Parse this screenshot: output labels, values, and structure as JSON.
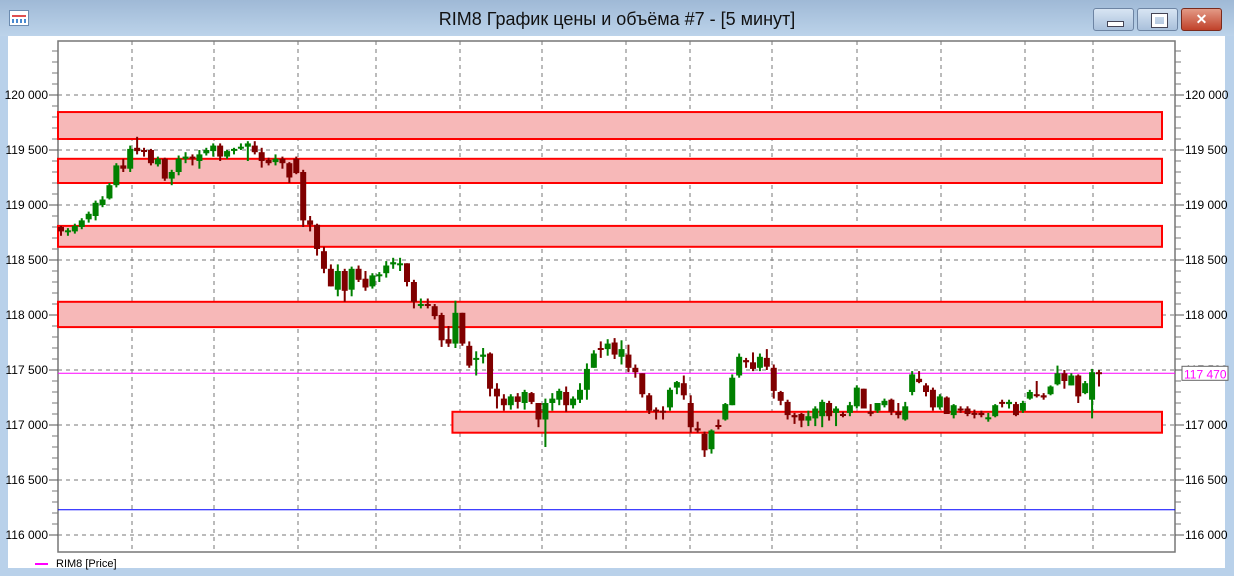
{
  "window": {
    "title": "RIM8 График цены и объёма #7 - [5 минут]",
    "buttons": [
      "minimize",
      "maximize",
      "close"
    ]
  },
  "legend": {
    "label": "RIM8 [Price]",
    "color": "#ff00ff"
  },
  "chart_data": {
    "type": "candlestick",
    "ylim": [
      115970,
      120470
    ],
    "y_ticks": [
      116000,
      116500,
      117000,
      117500,
      118000,
      118500,
      119000,
      119500,
      120000
    ],
    "y_tick_labels": [
      "116 000",
      "116 500",
      "117 000",
      "117 500",
      "118 000",
      "118 500",
      "119 000",
      "119 500",
      "120 000"
    ],
    "grid": true,
    "colors": {
      "up": "#008000",
      "down": "#800000",
      "zone_fill": "#f7b8b8",
      "zone_border": "#ff0000",
      "last_price": "#ff00ff",
      "level_line": "#0000ff"
    },
    "last_price": {
      "value": 117470,
      "label": "117 470"
    },
    "level_line": 116230,
    "zones": [
      {
        "low": 119600,
        "high": 119845,
        "from_candle": 0
      },
      {
        "low": 119200,
        "high": 119420,
        "from_candle": 0
      },
      {
        "low": 118620,
        "high": 118810,
        "from_candle": 0
      },
      {
        "low": 117890,
        "high": 118120,
        "from_candle": 0
      },
      {
        "low": 116930,
        "high": 117120,
        "from_candle": 57
      }
    ],
    "candles_ohlc": [
      [
        118800,
        118810,
        118720,
        118760
      ],
      [
        118760,
        118790,
        118720,
        118770
      ],
      [
        118760,
        118830,
        118740,
        118810
      ],
      [
        118800,
        118880,
        118780,
        118860
      ],
      [
        118870,
        118940,
        118840,
        118920
      ],
      [
        118900,
        119040,
        118860,
        119020
      ],
      [
        119000,
        119080,
        118980,
        119050
      ],
      [
        119060,
        119200,
        119050,
        119180
      ],
      [
        119180,
        119380,
        119160,
        119360
      ],
      [
        119360,
        119420,
        119300,
        119330
      ],
      [
        119330,
        119540,
        119300,
        119510
      ],
      [
        119520,
        119620,
        119460,
        119490
      ],
      [
        119500,
        119520,
        119440,
        119490
      ],
      [
        119500,
        119510,
        119360,
        119380
      ],
      [
        119370,
        119440,
        119350,
        119420
      ],
      [
        119420,
        119430,
        119220,
        119240
      ],
      [
        119240,
        119320,
        119180,
        119300
      ],
      [
        119300,
        119450,
        119270,
        119420
      ],
      [
        119420,
        119480,
        119380,
        119440
      ],
      [
        119440,
        119460,
        119360,
        119430
      ],
      [
        119400,
        119500,
        119330,
        119460
      ],
      [
        119470,
        119520,
        119450,
        119500
      ],
      [
        119490,
        119560,
        119440,
        119540
      ],
      [
        119540,
        119560,
        119400,
        119440
      ],
      [
        119440,
        119500,
        119420,
        119490
      ],
      [
        119500,
        119520,
        119460,
        119510
      ],
      [
        119520,
        119560,
        119500,
        119530
      ],
      [
        119530,
        119580,
        119400,
        119560
      ],
      [
        119540,
        119580,
        119460,
        119480
      ],
      [
        119480,
        119520,
        119340,
        119400
      ],
      [
        119410,
        119430,
        119360,
        119380
      ],
      [
        119390,
        119460,
        119360,
        119420
      ],
      [
        119420,
        119440,
        119330,
        119380
      ],
      [
        119380,
        119390,
        119200,
        119250
      ],
      [
        119420,
        119440,
        119280,
        119290
      ],
      [
        119300,
        119320,
        118800,
        118860
      ],
      [
        118860,
        118900,
        118760,
        118820
      ],
      [
        118820,
        118830,
        118540,
        118600
      ],
      [
        118580,
        118620,
        118380,
        118420
      ],
      [
        118420,
        118460,
        118260,
        118260
      ],
      [
        118230,
        118460,
        118170,
        118400
      ],
      [
        118400,
        118420,
        118120,
        118220
      ],
      [
        118230,
        118440,
        118170,
        118420
      ],
      [
        118420,
        118450,
        118300,
        118320
      ],
      [
        118330,
        118400,
        118220,
        118250
      ],
      [
        118260,
        118380,
        118240,
        118360
      ],
      [
        118360,
        118390,
        118300,
        118370
      ],
      [
        118380,
        118490,
        118340,
        118450
      ],
      [
        118460,
        118520,
        118420,
        118480
      ],
      [
        118470,
        118520,
        118400,
        118470
      ],
      [
        118470,
        118470,
        118260,
        118300
      ],
      [
        118300,
        118320,
        118060,
        118120
      ],
      [
        118100,
        118150,
        118060,
        118100
      ],
      [
        118100,
        118150,
        118060,
        118090
      ],
      [
        118080,
        118100,
        117960,
        117990
      ],
      [
        118000,
        118020,
        117710,
        117770
      ],
      [
        117780,
        117900,
        117710,
        117740
      ],
      [
        117740,
        118130,
        117700,
        118020
      ],
      [
        118020,
        118020,
        117720,
        117740
      ],
      [
        117720,
        117760,
        117520,
        117540
      ],
      [
        117600,
        117670,
        117450,
        117610
      ],
      [
        117620,
        117700,
        117560,
        117640
      ],
      [
        117650,
        117660,
        117260,
        117330
      ],
      [
        117330,
        117380,
        117150,
        117260
      ],
      [
        117240,
        117280,
        117130,
        117180
      ],
      [
        117180,
        117280,
        117140,
        117260
      ],
      [
        117260,
        117290,
        117150,
        117210
      ],
      [
        117200,
        117320,
        117140,
        117300
      ],
      [
        117290,
        117300,
        117190,
        117210
      ],
      [
        117200,
        117200,
        116980,
        117050
      ],
      [
        117050,
        117240,
        116800,
        117200
      ],
      [
        117200,
        117290,
        117130,
        117240
      ],
      [
        117230,
        117330,
        117180,
        117310
      ],
      [
        117300,
        117350,
        117120,
        117180
      ],
      [
        117180,
        117260,
        117150,
        117240
      ],
      [
        117230,
        117380,
        117200,
        117320
      ],
      [
        117320,
        117560,
        117230,
        117510
      ],
      [
        117520,
        117680,
        117520,
        117650
      ],
      [
        117700,
        117760,
        117610,
        117690
      ],
      [
        117690,
        117780,
        117630,
        117740
      ],
      [
        117750,
        117790,
        117600,
        117640
      ],
      [
        117620,
        117770,
        117550,
        117690
      ],
      [
        117640,
        117730,
        117480,
        117520
      ],
      [
        117520,
        117550,
        117430,
        117480
      ],
      [
        117470,
        117470,
        117250,
        117280
      ],
      [
        117270,
        117290,
        117100,
        117130
      ],
      [
        117140,
        117160,
        117050,
        117130
      ],
      [
        117130,
        117170,
        117050,
        117120
      ],
      [
        117160,
        117340,
        117130,
        117320
      ],
      [
        117340,
        117400,
        117280,
        117390
      ],
      [
        117380,
        117450,
        117230,
        117270
      ],
      [
        117200,
        117270,
        116930,
        116980
      ],
      [
        116970,
        117030,
        116930,
        116950
      ],
      [
        116920,
        116940,
        116710,
        116770
      ],
      [
        116780,
        116960,
        116740,
        116950
      ],
      [
        117000,
        117050,
        116960,
        116990
      ],
      [
        117050,
        117200,
        117040,
        117190
      ],
      [
        117180,
        117460,
        117180,
        117430
      ],
      [
        117450,
        117650,
        117430,
        117620
      ],
      [
        117590,
        117610,
        117520,
        117570
      ],
      [
        117570,
        117660,
        117490,
        117510
      ],
      [
        117520,
        117650,
        117490,
        117620
      ],
      [
        117610,
        117690,
        117500,
        117530
      ],
      [
        117520,
        117550,
        117240,
        117310
      ],
      [
        117300,
        117310,
        117180,
        117220
      ],
      [
        117210,
        117230,
        117050,
        117090
      ],
      [
        117090,
        117110,
        117010,
        117070
      ],
      [
        117100,
        117110,
        116980,
        117040
      ],
      [
        117040,
        117130,
        116990,
        117080
      ],
      [
        117060,
        117170,
        116990,
        117150
      ],
      [
        117080,
        117230,
        116980,
        117210
      ],
      [
        117200,
        117220,
        117040,
        117080
      ],
      [
        117110,
        117170,
        116990,
        117150
      ],
      [
        117100,
        117120,
        117070,
        117090
      ],
      [
        117110,
        117210,
        117080,
        117180
      ],
      [
        117170,
        117360,
        117150,
        117340
      ],
      [
        117330,
        117330,
        117150,
        117150
      ],
      [
        117120,
        117190,
        117080,
        117110
      ],
      [
        117130,
        117200,
        117110,
        117200
      ],
      [
        117180,
        117240,
        117160,
        117220
      ],
      [
        117230,
        117240,
        117090,
        117120
      ],
      [
        117120,
        117200,
        117060,
        117090
      ],
      [
        117050,
        117210,
        117040,
        117170
      ],
      [
        117300,
        117490,
        117270,
        117460
      ],
      [
        117420,
        117490,
        117380,
        117390
      ],
      [
        117360,
        117380,
        117260,
        117300
      ],
      [
        117320,
        117340,
        117130,
        117160
      ],
      [
        117160,
        117280,
        117140,
        117260
      ],
      [
        117250,
        117260,
        117100,
        117100
      ],
      [
        117090,
        117190,
        117060,
        117180
      ],
      [
        117150,
        117170,
        117110,
        117140
      ],
      [
        117150,
        117170,
        117080,
        117100
      ],
      [
        117110,
        117140,
        117060,
        117100
      ],
      [
        117110,
        117130,
        117070,
        117090
      ],
      [
        117060,
        117110,
        117030,
        117070
      ],
      [
        117080,
        117190,
        117070,
        117180
      ],
      [
        117210,
        117230,
        117160,
        117200
      ],
      [
        117190,
        117230,
        117150,
        117210
      ],
      [
        117190,
        117210,
        117080,
        117090
      ],
      [
        117130,
        117220,
        117110,
        117200
      ],
      [
        117240,
        117320,
        117230,
        117300
      ],
      [
        117280,
        117400,
        117250,
        117270
      ],
      [
        117270,
        117290,
        117230,
        117250
      ],
      [
        117280,
        117360,
        117270,
        117350
      ],
      [
        117370,
        117540,
        117360,
        117470
      ],
      [
        117470,
        117500,
        117330,
        117400
      ],
      [
        117360,
        117470,
        117360,
        117450
      ],
      [
        117450,
        117460,
        117200,
        117260
      ],
      [
        117290,
        117400,
        117280,
        117380
      ],
      [
        117230,
        117510,
        117060,
        117480
      ],
      [
        117480,
        117500,
        117350,
        117470
      ]
    ]
  }
}
